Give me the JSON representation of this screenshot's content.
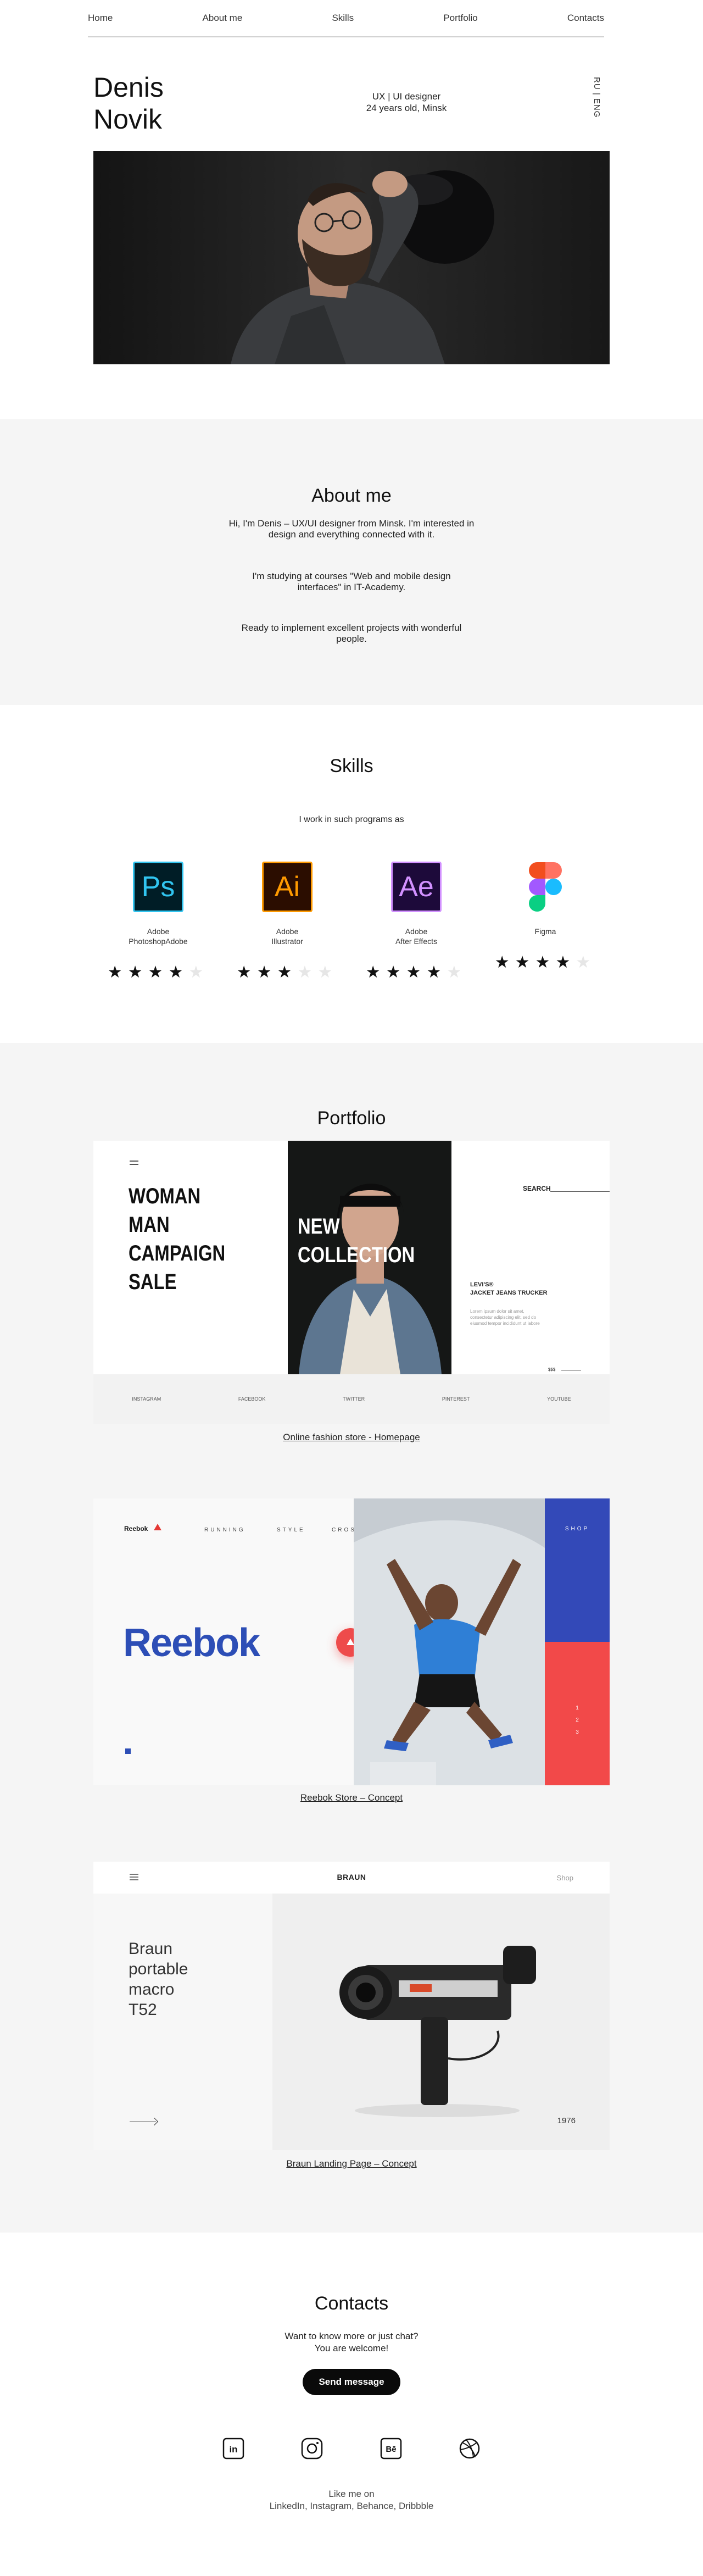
{
  "nav": {
    "items": [
      "Home",
      "About me",
      "Skills",
      "Portfolio",
      "Contacts"
    ]
  },
  "hero": {
    "first_name": "Denis",
    "last_name": "Novik",
    "role": "UX | UI designer",
    "age_city": "24 years old, Minsk",
    "lang": "RU | ENG"
  },
  "about": {
    "title": "About me",
    "p1": "Hi, I'm Denis – UX/UI designer from Minsk. I'm interested in design and everything connected with it.",
    "p2": "I'm studying at courses \"Web and mobile design interfaces\" in IT-Academy.",
    "p3": "Ready to implement excellent projects with wonderful people."
  },
  "skills": {
    "title": "Skills",
    "lead": "I work in such programs as",
    "items": [
      {
        "abbr": "Ps",
        "line1": "Adobe",
        "line2": "PhotoshopAdobe",
        "rating": 4,
        "icon": "photoshop-icon",
        "bg": "#001d26",
        "fg": "#31c5f0"
      },
      {
        "abbr": "Ai",
        "line1": "Adobe",
        "line2": "Illustrator",
        "rating": 3,
        "icon": "illustrator-icon",
        "bg": "#2b0d00",
        "fg": "#ff9a00"
      },
      {
        "abbr": "Ae",
        "line1": "Adobe",
        "line2": "After Effects",
        "rating": 4,
        "icon": "after-effects-icon",
        "bg": "#1d0a3a",
        "fg": "#d291ff"
      },
      {
        "abbr": "",
        "line1": "Figma",
        "line2": "",
        "rating": 4,
        "icon": "figma-icon",
        "bg": "",
        "fg": ""
      }
    ],
    "star": "★",
    "max_rating": 5
  },
  "portfolio": {
    "title": "Portfolio",
    "p1": {
      "caption": "Online fashion store - Homepage",
      "headline": [
        "WOMAN",
        "MAN",
        "CAMPAIGN",
        "SALE"
      ],
      "collection": [
        "NEW",
        "COLLECTION"
      ],
      "search": "SEARCH",
      "product": [
        "LEVI'S®",
        "JACKET JEANS TRUCKER"
      ],
      "product_desc": "Lorem ipsum dolor sit amet, consectetur adipiscing elit, sed do eiusmod tempor incididunt ut labore",
      "price": "$$$",
      "footer": [
        "INSTAGRAM",
        "FACEBOOK",
        "TWITTER",
        "PINTEREST",
        "YOUTUBE"
      ]
    },
    "p2": {
      "caption": "Reebok Store – Concept",
      "logo": "Reebok",
      "nav": [
        "RUNNING",
        "STYLE",
        "CROSSFIT"
      ],
      "shop": "SHOP",
      "counter": [
        "1",
        "2",
        "3"
      ]
    },
    "p3": {
      "caption": "Braun Landing Page – Concept",
      "brand": "BRAUN",
      "shop": "Shop",
      "product": [
        "Braun",
        "portable",
        "macro",
        "T52"
      ],
      "year": "1976"
    }
  },
  "contacts": {
    "title": "Contacts",
    "line1": "Want to know more or just chat?",
    "line2": "You are welcome!",
    "button": "Send message",
    "social": [
      {
        "icon": "linkedin-icon",
        "glyph": "in"
      },
      {
        "icon": "instagram-icon",
        "glyph": ""
      },
      {
        "icon": "behance-icon",
        "glyph": "Bē"
      },
      {
        "icon": "dribbble-icon",
        "glyph": ""
      }
    ],
    "like1": "Like me on",
    "like2": "LinkedIn, Instagram, Behance, Dribbble"
  }
}
